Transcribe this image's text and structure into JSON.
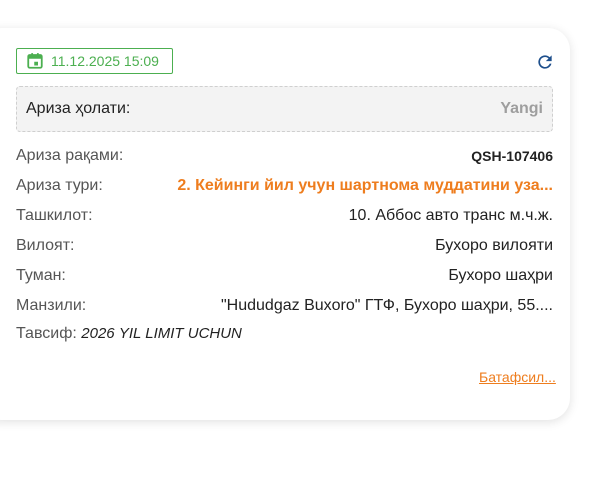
{
  "card": {
    "date": "11.12.2025 15:09",
    "icons": {
      "date": "calendar-icon",
      "refresh": "refresh-icon"
    },
    "status": {
      "label": "Ариза ҳолати:",
      "value": "Yangi"
    },
    "fields": [
      {
        "label": "Ариза рақами:",
        "value": "QSH-107406"
      },
      {
        "label": "Ариза тури:",
        "value": "2. Кейинги йил учун шартнома муддатини уза..."
      },
      {
        "label": "Ташкилот:",
        "value": "10. Аббос авто транс м.ч.ж."
      },
      {
        "label": "Вилоят:",
        "value": "Бухоро вилояти"
      },
      {
        "label": "Туман:",
        "value": "Бухоро шаҳри"
      },
      {
        "label": "Манзили:",
        "value": "\"Hududgaz Buxoro\" ГТФ, Бухоро шаҳри, 55...."
      }
    ],
    "description": {
      "label": "Тавсиф:",
      "value": "2026 YIL LIMIT UCHUN"
    },
    "more_link": "Батафсил...",
    "colors": {
      "green": "#4caf50",
      "orange": "#ee7d1e",
      "refresh_blue": "#1e4f8c",
      "status_gray": "#9e9e9e"
    }
  }
}
